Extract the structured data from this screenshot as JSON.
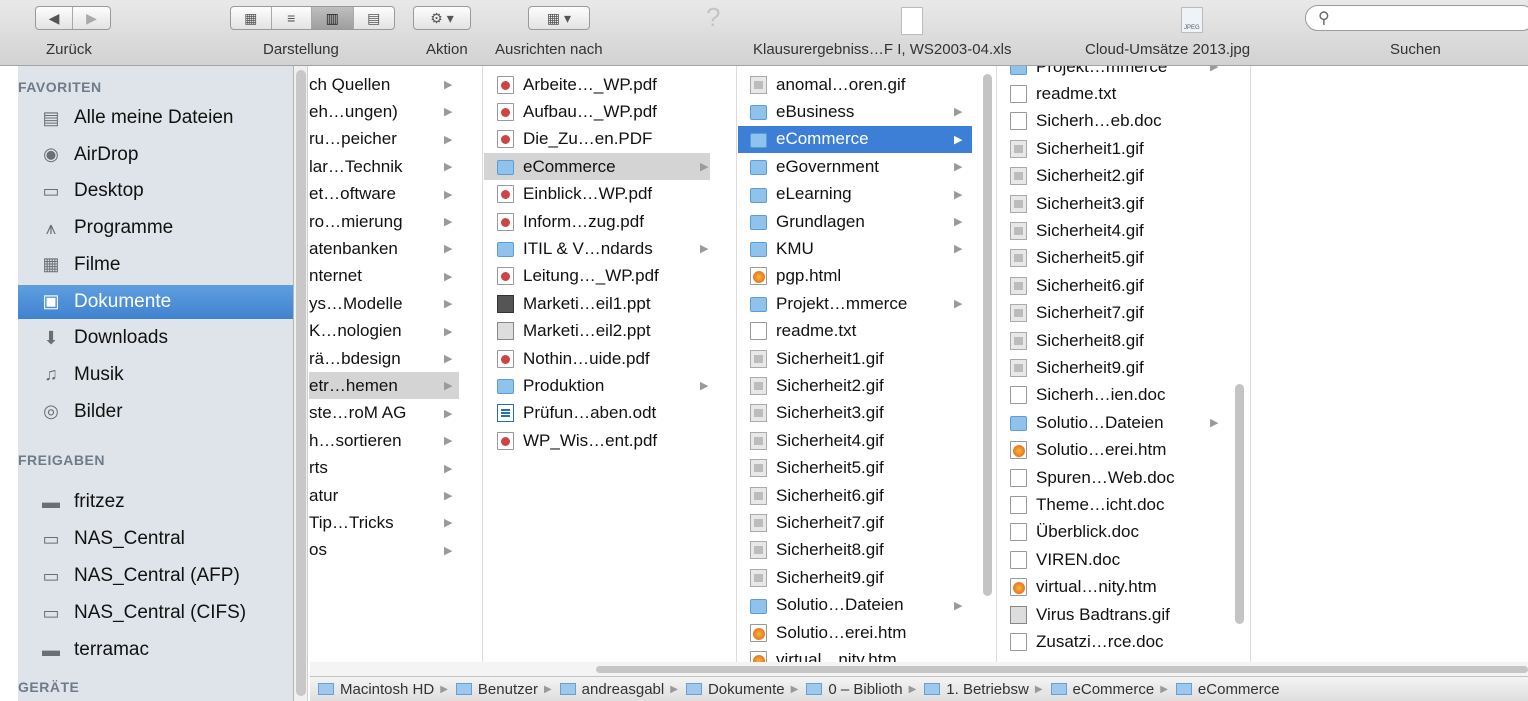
{
  "toolbar": {
    "nav_back_label": "Zurück",
    "view_label": "Darstellung",
    "action_label": "Aktion",
    "arrange_label": "Ausrichten nach",
    "file1_label": "Klausurergebniss…F I, WS2003-04.xls",
    "file2_label": "Cloud-Umsätze 2013.jpg",
    "jpeg_badge": "JPEG",
    "search_label": "Suchen",
    "search_placeholder": ""
  },
  "sidebar": {
    "favorites_header": "FAVORITEN",
    "favorites": [
      {
        "label": "Alle meine Dateien",
        "icon": "all-files-icon"
      },
      {
        "label": "AirDrop",
        "icon": "airdrop-icon"
      },
      {
        "label": "Desktop",
        "icon": "desktop-icon"
      },
      {
        "label": "Programme",
        "icon": "applications-icon"
      },
      {
        "label": "Filme",
        "icon": "movies-icon"
      },
      {
        "label": "Dokumente",
        "icon": "documents-icon",
        "selected": true
      },
      {
        "label": "Downloads",
        "icon": "downloads-icon"
      },
      {
        "label": "Musik",
        "icon": "music-icon"
      },
      {
        "label": "Bilder",
        "icon": "pictures-icon"
      }
    ],
    "shared_header": "FREIGABEN",
    "shared": [
      {
        "label": "fritzez",
        "icon": "computer-icon"
      },
      {
        "label": "NAS_Central",
        "icon": "server-icon"
      },
      {
        "label": "NAS_Central (AFP)",
        "icon": "server-icon"
      },
      {
        "label": "NAS_Central (CIFS)",
        "icon": "server-icon"
      },
      {
        "label": "terramac",
        "icon": "computer-icon"
      }
    ],
    "devices_header": "GERÄTE"
  },
  "columns": {
    "col1": [
      "ch Quellen",
      "eh…ungen)",
      "ru…peicher",
      "lar…Technik",
      "et…oftware",
      "ro…mierung",
      "atenbanken",
      "nternet",
      "ys…Modelle",
      "K…nologien",
      "rä…bdesign",
      "etr…hemen",
      "ste…roM AG",
      "h…sortieren",
      "rts",
      "atur",
      "Tip…Tricks",
      "os"
    ],
    "col2": [
      {
        "name": "Arbeite…_WP.pdf",
        "type": "pdf"
      },
      {
        "name": "Aufbau…_WP.pdf",
        "type": "pdf"
      },
      {
        "name": "Die_Zu…en.PDF",
        "type": "pdf"
      },
      {
        "name": "eCommerce",
        "type": "folder"
      },
      {
        "name": "Einblick…WP.pdf",
        "type": "pdf"
      },
      {
        "name": "Inform…zug.pdf",
        "type": "pdf"
      },
      {
        "name": "ITIL & V…ndards",
        "type": "folder"
      },
      {
        "name": "Leitung…_WP.pdf",
        "type": "pdf"
      },
      {
        "name": "Marketi…eil1.ppt",
        "type": "ppt"
      },
      {
        "name": "Marketi…eil2.ppt",
        "type": "ppt2"
      },
      {
        "name": "Nothin…uide.pdf",
        "type": "pdf"
      },
      {
        "name": "Produktion",
        "type": "folder"
      },
      {
        "name": "Prüfun…aben.odt",
        "type": "odt"
      },
      {
        "name": "WP_Wis…ent.pdf",
        "type": "pdf"
      }
    ],
    "col3": [
      {
        "name": "anomal…oren.gif",
        "type": "img"
      },
      {
        "name": "eBusiness",
        "type": "folder"
      },
      {
        "name": "eCommerce",
        "type": "folder"
      },
      {
        "name": "eGovernment",
        "type": "folder"
      },
      {
        "name": "eLearning",
        "type": "folder"
      },
      {
        "name": "Grundlagen",
        "type": "folder"
      },
      {
        "name": "KMU",
        "type": "folder"
      },
      {
        "name": "pgp.html",
        "type": "web"
      },
      {
        "name": "Projekt…mmerce",
        "type": "folder"
      },
      {
        "name": "readme.txt",
        "type": "doc"
      },
      {
        "name": "Sicherheit1.gif",
        "type": "img"
      },
      {
        "name": "Sicherheit2.gif",
        "type": "img"
      },
      {
        "name": "Sicherheit3.gif",
        "type": "img"
      },
      {
        "name": "Sicherheit4.gif",
        "type": "img"
      },
      {
        "name": "Sicherheit5.gif",
        "type": "img"
      },
      {
        "name": "Sicherheit6.gif",
        "type": "img"
      },
      {
        "name": "Sicherheit7.gif",
        "type": "img"
      },
      {
        "name": "Sicherheit8.gif",
        "type": "img"
      },
      {
        "name": "Sicherheit9.gif",
        "type": "img"
      },
      {
        "name": "Solutio…Dateien",
        "type": "folder"
      },
      {
        "name": "Solutio…erei.htm",
        "type": "web"
      },
      {
        "name": "virtual…nity.htm",
        "type": "web"
      }
    ],
    "col4": [
      {
        "name": "Projekt…mmerce",
        "type": "folder"
      },
      {
        "name": "readme.txt",
        "type": "doc"
      },
      {
        "name": "Sicherh…eb.doc",
        "type": "doc"
      },
      {
        "name": "Sicherheit1.gif",
        "type": "img"
      },
      {
        "name": "Sicherheit2.gif",
        "type": "img"
      },
      {
        "name": "Sicherheit3.gif",
        "type": "img"
      },
      {
        "name": "Sicherheit4.gif",
        "type": "img"
      },
      {
        "name": "Sicherheit5.gif",
        "type": "img"
      },
      {
        "name": "Sicherheit6.gif",
        "type": "img"
      },
      {
        "name": "Sicherheit7.gif",
        "type": "img"
      },
      {
        "name": "Sicherheit8.gif",
        "type": "img"
      },
      {
        "name": "Sicherheit9.gif",
        "type": "img"
      },
      {
        "name": "Sicherh…ien.doc",
        "type": "doc"
      },
      {
        "name": "Solutio…Dateien",
        "type": "folder"
      },
      {
        "name": "Solutio…erei.htm",
        "type": "web"
      },
      {
        "name": "Spuren…Web.doc",
        "type": "doc"
      },
      {
        "name": "Theme…icht.doc",
        "type": "doc"
      },
      {
        "name": "Überblick.doc",
        "type": "doc"
      },
      {
        "name": "VIREN.doc",
        "type": "doc"
      },
      {
        "name": "virtual…nity.htm",
        "type": "web"
      },
      {
        "name": "Virus Badtrans.gif",
        "type": "ppt2"
      },
      {
        "name": "Zusatzi…rce.doc",
        "type": "doc"
      }
    ]
  },
  "pathbar": [
    "Macintosh HD",
    "Benutzer",
    "andreasgabl",
    "Dokumente",
    "0 – Biblioth",
    "1. Betriebsw",
    "eCommerce",
    "eCommerce"
  ]
}
